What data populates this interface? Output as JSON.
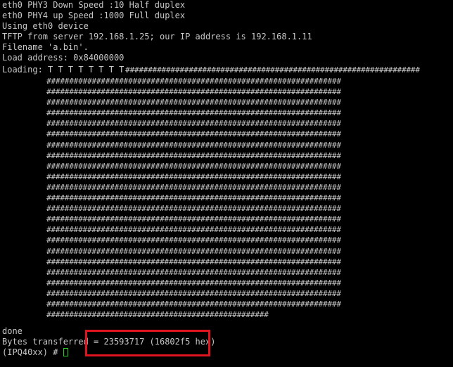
{
  "terminal": {
    "colors": {
      "background": "#000000",
      "foreground": "#c7c7c7",
      "highlight": "#e0141e",
      "cursor": "#21d321"
    },
    "header_lines": [
      "eth0 PHY3 Down Speed :10 Half duplex",
      "eth0 PHY4 up Speed :1000 Full duplex",
      "Using eth0 device",
      "TFTP from server 192.168.1.25; our IP address is 192.168.1.11",
      "Filename 'a.bin'.",
      "Load address: 0x84000000"
    ],
    "loading_label": "Loading: T T T T T T T T",
    "loading_hashes": "#################################################################",
    "hash_line": "#################################################################",
    "last_hash_line": "#################################################",
    "footer_done": "done",
    "bytes_transferred": "Bytes transferred = 23593717 (16802f5 hex)",
    "prompt": "(IPQ40xx) # "
  }
}
